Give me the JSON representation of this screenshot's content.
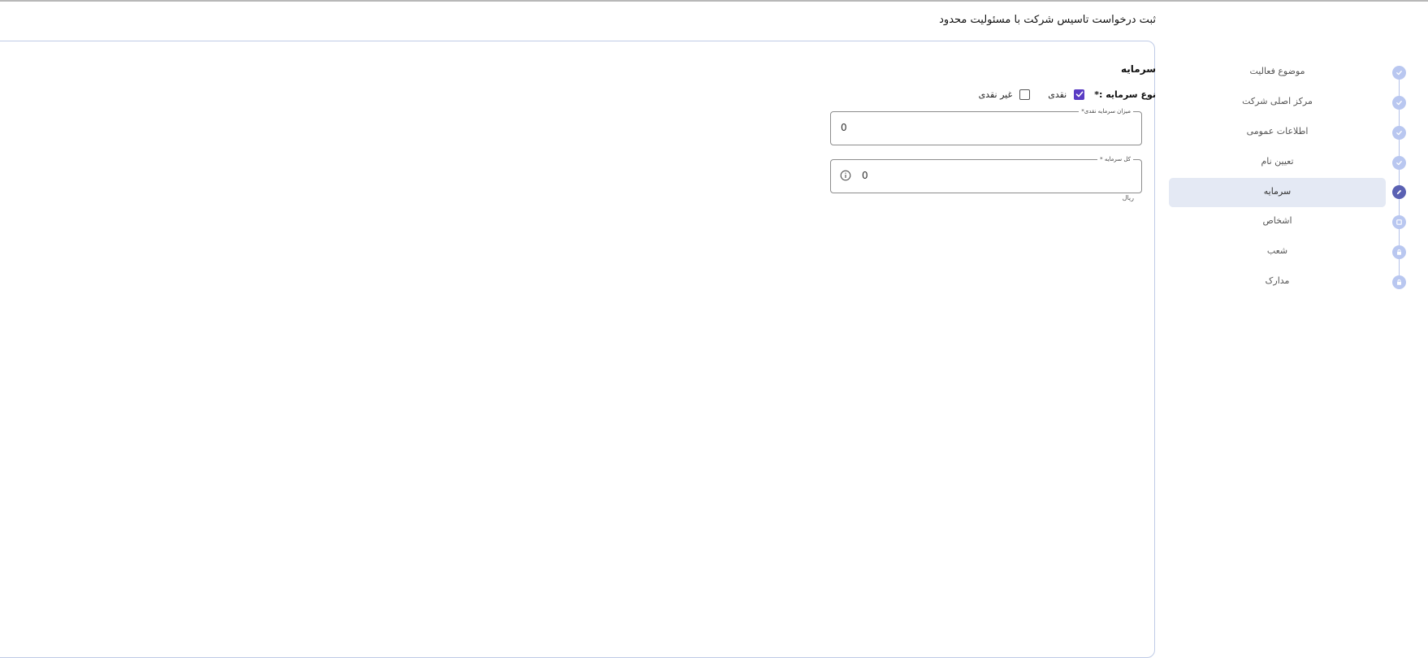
{
  "page": {
    "title": "ثبت درخواست تاسیس شرکت با مسئولیت محدود"
  },
  "form": {
    "section_title": "سرمایه",
    "capital_type": {
      "label": "نوع سرمایه :*",
      "options": [
        {
          "label": "نقدی",
          "checked": true
        },
        {
          "label": "غیر نقدی",
          "checked": false
        }
      ]
    },
    "cash_amount": {
      "label": "میزان سرمایه نقدی*",
      "value": "0"
    },
    "total_capital": {
      "label": "کل سرمایه *",
      "value": "0",
      "helper": "ریال",
      "icon": "info-icon"
    }
  },
  "stepper": {
    "steps": [
      {
        "label": "موضوع فعالیت",
        "status": "done",
        "icon": "check-icon"
      },
      {
        "label": "مرکز اصلی شرکت",
        "status": "done",
        "icon": "check-icon"
      },
      {
        "label": "اطلاعات عمومی",
        "status": "done",
        "icon": "check-icon"
      },
      {
        "label": "تعیین نام",
        "status": "done",
        "icon": "check-icon"
      },
      {
        "label": "سرمایه",
        "status": "active",
        "icon": "pencil-icon"
      },
      {
        "label": "اشخاص",
        "status": "pending",
        "icon": "square-icon"
      },
      {
        "label": "شعب",
        "status": "locked",
        "icon": "lock-icon"
      },
      {
        "label": "مدارک",
        "status": "locked",
        "icon": "lock-icon"
      }
    ]
  },
  "colors": {
    "accent": "#5a3cc4",
    "step_done": "#b9c7f0",
    "step_active": "#5a61b3",
    "active_bg": "#e4e9f4",
    "card_border": "#bfcbe6"
  }
}
